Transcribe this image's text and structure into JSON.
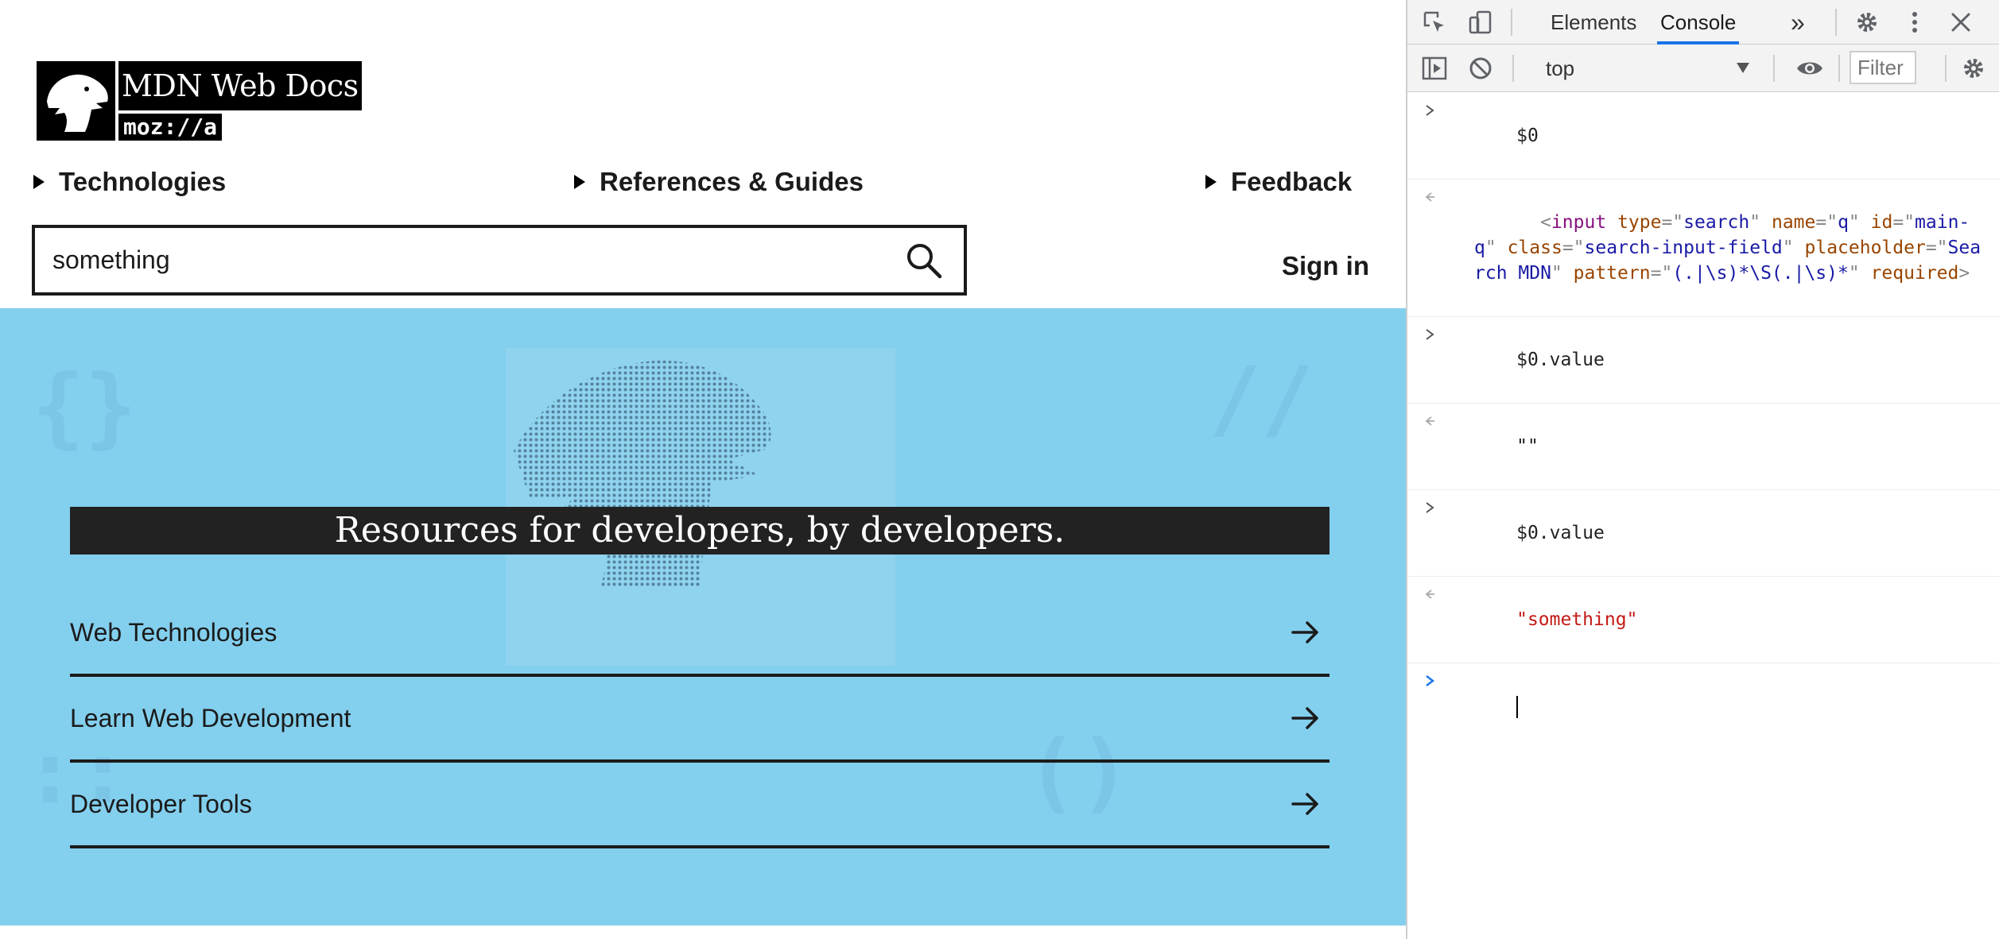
{
  "page": {
    "logo": {
      "title": "MDN Web Docs",
      "subtitle": "moz://a"
    },
    "nav": [
      {
        "label": "Technologies"
      },
      {
        "label": "References & Guides"
      },
      {
        "label": "Feedback"
      }
    ],
    "search": {
      "value": "something",
      "placeholder": "Search MDN"
    },
    "sign_in": "Sign in",
    "hero": {
      "title": "Resources for developers, by developers.",
      "links": [
        {
          "label": "Web Technologies"
        },
        {
          "label": "Learn Web Development"
        },
        {
          "label": "Developer Tools"
        }
      ]
    },
    "colors": {
      "hero_bg": "#83cfee",
      "title_bg": "#222222",
      "accent": "#1a73e8"
    }
  },
  "devtools": {
    "tabs": {
      "elements": "Elements",
      "console": "Console",
      "more": "»"
    },
    "context": "top",
    "filter_placeholder": "Filter",
    "icons": [
      "inspect-icon",
      "device-toggle-icon",
      "settings-icon",
      "more-vert-icon",
      "close-icon",
      "sidebar-toggle-icon",
      "clear-console-icon",
      "eye-icon"
    ],
    "console": {
      "entries": [
        {
          "input": "$0"
        },
        {
          "output": {
            "tag_open": "<",
            "tag": "input",
            "attrs": [
              {
                "name": "type",
                "value": "search"
              },
              {
                "name": "name",
                "value": "q"
              },
              {
                "name": "id",
                "value": "main-q"
              },
              {
                "name": "class",
                "value": "search-input-field"
              },
              {
                "name": "placeholder",
                "value": "Search MDN"
              },
              {
                "name": "pattern",
                "value": "(.|\\s)*\\S(.|\\s)*"
              }
            ],
            "flag": "required",
            "tag_close": ">"
          }
        },
        {
          "input": "$0.value"
        },
        {
          "output_text": "\"\""
        },
        {
          "input": "$0.value"
        },
        {
          "output_text": "\"something\""
        }
      ]
    }
  }
}
